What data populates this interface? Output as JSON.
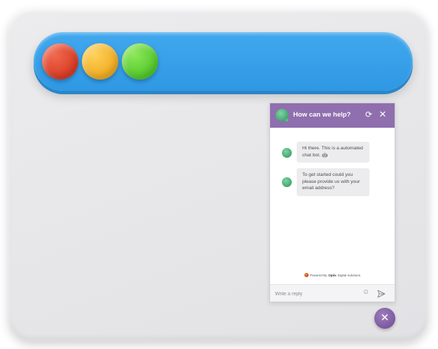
{
  "chat": {
    "title": "How can we help?",
    "refresh_icon": "refresh-icon",
    "close_icon": "close-icon",
    "messages": [
      {
        "text": "Hi there. This is a automated chat bot. 🤖"
      },
      {
        "text": "To get started could you please provide us with your email address?"
      }
    ],
    "powered": {
      "prefix": "Powered By",
      "brand": "Optix",
      "suffix": "Digital Solutions"
    },
    "reply_placeholder": "Write a reply",
    "emoji_icon": "emoji-icon",
    "send_icon": "send-icon"
  },
  "fab": {
    "icon": "close-icon"
  },
  "colors": {
    "titlebar": "#3aa2ea",
    "chat_header": "#8f6fae",
    "dot_red": "#e4472f",
    "dot_yellow": "#f5b62d",
    "dot_green": "#62d036"
  }
}
